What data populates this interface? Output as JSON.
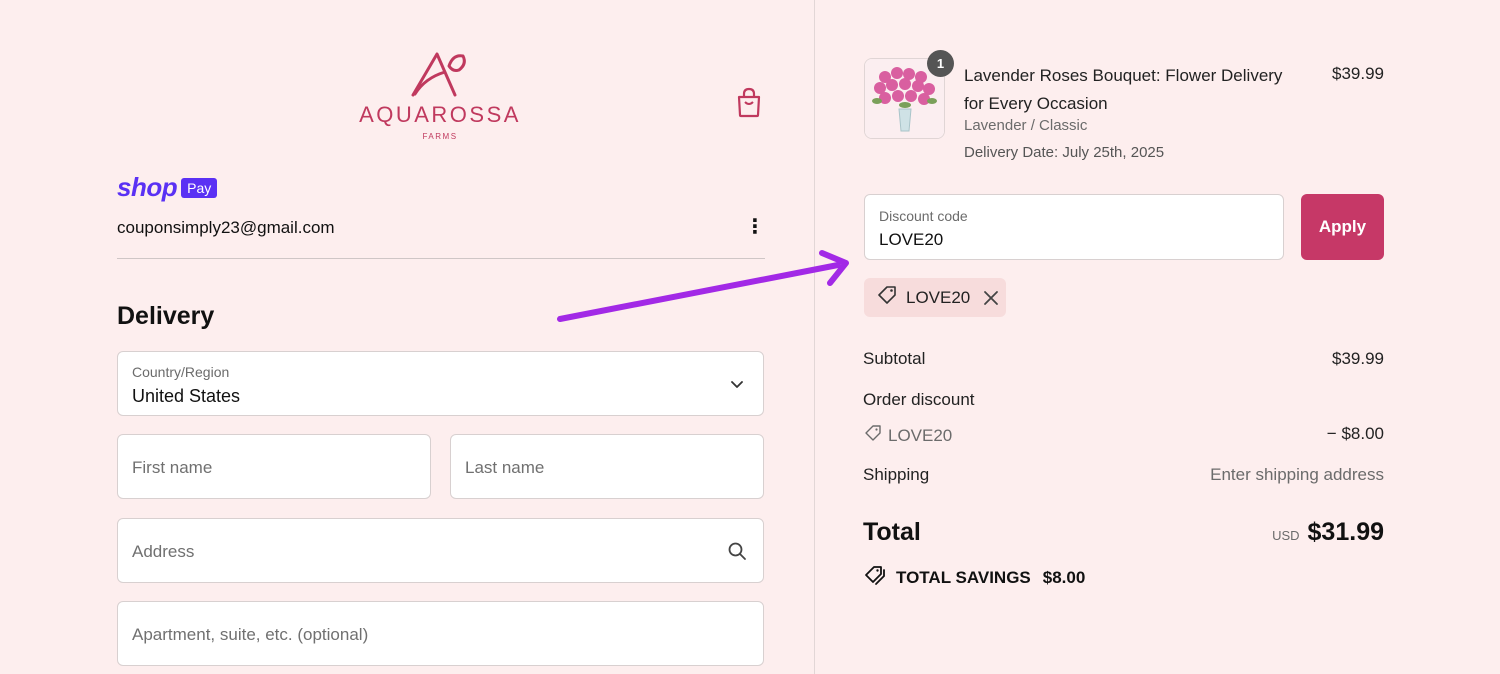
{
  "brand": {
    "name": "AQUAROSSA",
    "subtitle": "FARMS",
    "accent_color": "#c0395e"
  },
  "shop_pay": {
    "shop_label": "shop",
    "pay_label": "Pay",
    "color": "#5a31f4"
  },
  "account": {
    "email": "couponsimply23@gmail.com"
  },
  "delivery": {
    "title": "Delivery",
    "country": {
      "label": "Country/Region",
      "value": "United States"
    },
    "first_name_placeholder": "First name",
    "last_name_placeholder": "Last name",
    "address_placeholder": "Address",
    "apartment_placeholder": "Apartment, suite, etc. (optional)"
  },
  "order": {
    "product": {
      "quantity": "1",
      "name": "Lavender Roses Bouquet: Flower Delivery for Every Occasion",
      "variant": "Lavender / Classic",
      "delivery_date": "Delivery Date: July 25th, 2025",
      "price": "$39.99"
    },
    "discount": {
      "label": "Discount code",
      "value": "LOVE20",
      "apply_label": "Apply",
      "applied_code": "LOVE20"
    },
    "summary": {
      "subtotal_label": "Subtotal",
      "subtotal_value": "$39.99",
      "order_discount_label": "Order discount",
      "discount_code": "LOVE20",
      "discount_value": "− $8.00",
      "shipping_label": "Shipping",
      "shipping_value": "Enter shipping address",
      "total_label": "Total",
      "currency": "USD",
      "total_value": "$31.99",
      "savings_label": "TOTAL SAVINGS",
      "savings_value": "$8.00"
    }
  },
  "icons": {
    "cart": "shopping-bag-icon",
    "menu": "kebab-menu-icon",
    "chevron": "chevron-down-icon",
    "search": "search-icon",
    "tag": "tag-icon",
    "close": "close-icon",
    "annotation": "arrow-annotation"
  },
  "colors": {
    "background": "#fdeeee",
    "apply_button": "#c63867",
    "arrow": "#a229e6"
  }
}
